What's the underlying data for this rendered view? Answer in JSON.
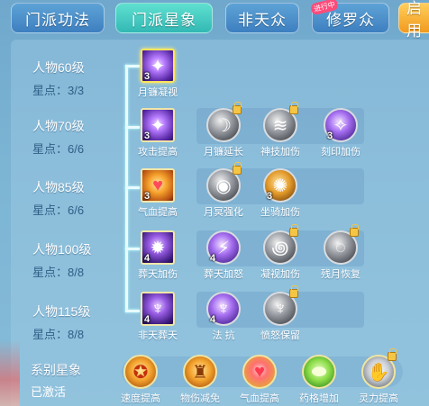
{
  "tabs": [
    {
      "label": "门派功法",
      "active": false
    },
    {
      "label": "门派星象",
      "active": true
    },
    {
      "label": "非天众",
      "active": false
    },
    {
      "label": "修罗众",
      "active": false,
      "badge": "进行中"
    },
    {
      "label": "启用",
      "active": false
    }
  ],
  "rows": [
    {
      "level": "人物60级",
      "points": "星点：3/3",
      "skills": [
        {
          "name": "月镰凝视",
          "count": "3",
          "icon": "purple-claw-icon",
          "selected": true
        }
      ]
    },
    {
      "level": "人物70级",
      "points": "星点：6/6",
      "skills": [
        {
          "name": "攻击提高",
          "count": "3",
          "icon": "purple-claw-icon"
        },
        {
          "name": "月镰延长",
          "count": "",
          "icon": "grey-sickle-icon",
          "locked": true
        },
        {
          "name": "神技加伤",
          "count": "",
          "icon": "grey-claw-icon",
          "locked": true
        },
        {
          "name": "刻印加伤",
          "count": "3",
          "icon": "purple-rune-icon"
        }
      ]
    },
    {
      "level": "人物85级",
      "points": "星点：6/6",
      "skills": [
        {
          "name": "气血提高",
          "count": "3",
          "icon": "heart-icon"
        },
        {
          "name": "月冥强化",
          "count": "",
          "icon": "grey-orb-icon",
          "locked": true
        },
        {
          "name": "坐骑加伤",
          "count": "3",
          "icon": "gold-beast-icon"
        }
      ]
    },
    {
      "level": "人物100级",
      "points": "星点：8/8",
      "skills": [
        {
          "name": "葬天加伤",
          "count": "4",
          "icon": "purple-beast-icon"
        },
        {
          "name": "葬天加怒",
          "count": "4",
          "icon": "purple-slash-icon"
        },
        {
          "name": "凝视加伤",
          "count": "",
          "icon": "grey-swirl-icon",
          "locked": true
        },
        {
          "name": "残月恢复",
          "count": "",
          "icon": "grey-moon-icon",
          "locked": true
        }
      ]
    },
    {
      "level": "人物115级",
      "points": "星点：8/8",
      "skills": [
        {
          "name": "非天葬天",
          "count": "4",
          "icon": "purple-demon-icon"
        },
        {
          "name": "法 抗",
          "count": "4",
          "icon": "purple-demon-icon"
        },
        {
          "name": "愤怒保留",
          "count": "",
          "icon": "grey-demon-icon",
          "locked": true
        }
      ]
    }
  ],
  "series": {
    "title": "系别星象",
    "status": "已激活",
    "skills": [
      {
        "name": "速度提高",
        "icon": "speed-icon"
      },
      {
        "name": "物伤减免",
        "icon": "physical-shield-icon"
      },
      {
        "name": "气血提高",
        "icon": "heart-icon"
      },
      {
        "name": "药格增加",
        "icon": "potion-icon"
      },
      {
        "name": "灵力提高",
        "icon": "spirit-icon",
        "locked": true
      }
    ]
  },
  "colors": {
    "tab_active": "#32b8b4",
    "tab_normal": "#3d7fc0",
    "tab_orange": "#f29a1e",
    "points_text": "#2f5f86"
  }
}
